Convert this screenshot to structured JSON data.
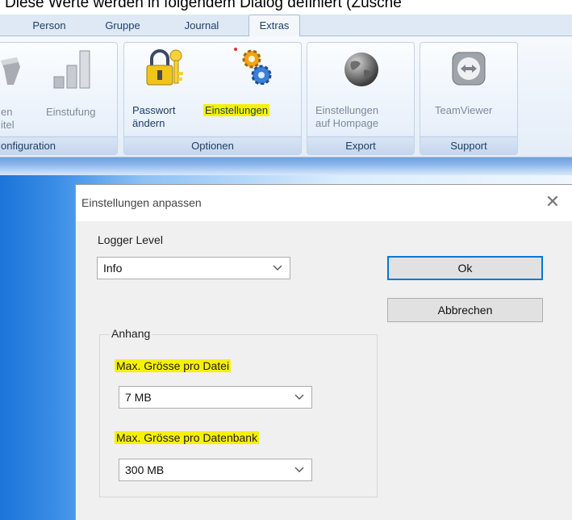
{
  "clipped_heading": "Diese Werte werden in folgendem Dialog definiert (Zusche",
  "ribbon": {
    "tabs": [
      {
        "label": "Person",
        "active": false
      },
      {
        "label": "Gruppe",
        "active": false
      },
      {
        "label": "Journal",
        "active": false
      },
      {
        "label": "Extras",
        "active": true
      }
    ],
    "groups": {
      "configuration": {
        "label": "onfiguration",
        "buttons": [
          {
            "label1": "en",
            "label2": "itel"
          },
          {
            "label1": "Einstufung",
            "label2": ""
          }
        ]
      },
      "optionen": {
        "label": "Optionen",
        "buttons": [
          {
            "label1": "Passwort",
            "label2": "ändern",
            "icon": "padlock-key-icon"
          },
          {
            "label1": "Einstellungen",
            "label2": "",
            "icon": "gears-icon",
            "highlighted": true
          }
        ]
      },
      "export": {
        "label": "Export",
        "buttons": [
          {
            "label1": "Einstellungen",
            "label2": "auf Hompage",
            "icon": "globe-icon"
          }
        ]
      },
      "support": {
        "label": "Support",
        "buttons": [
          {
            "label1": "TeamViewer",
            "label2": "",
            "icon": "teamviewer-icon"
          }
        ]
      }
    }
  },
  "dialog": {
    "title": "Einstellungen anpassen",
    "close_glyph": "✕",
    "logger_level": {
      "label": "Logger Level",
      "value": "Info"
    },
    "ok_label": "Ok",
    "cancel_label": "Abbrechen",
    "anhang": {
      "label": "Anhang",
      "max_file": {
        "label": "Max. Grösse pro Datei",
        "value": "7 MB"
      },
      "max_db": {
        "label": "Max. Grösse pro Datenbank",
        "value": "300 MB"
      }
    }
  },
  "colors": {
    "highlight": "#f5f100",
    "focus_border": "#0078d7",
    "ribbon_text": "#1e3e66"
  }
}
